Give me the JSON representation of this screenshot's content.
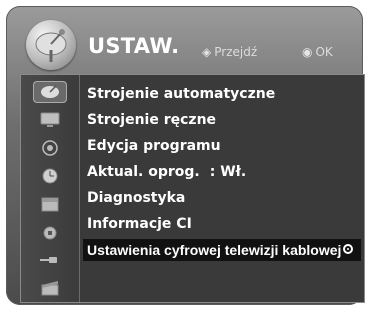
{
  "header": {
    "title": "USTAW.",
    "hint_move": "Przejdź",
    "hint_ok": "OK"
  },
  "sidebar": {
    "icons": [
      {
        "name": "satellite-dish-icon",
        "active": true
      },
      {
        "name": "screen-icon",
        "active": false
      },
      {
        "name": "audio-icon",
        "active": false
      },
      {
        "name": "clock-icon",
        "active": false
      },
      {
        "name": "calendar-icon",
        "active": false
      },
      {
        "name": "lock-icon",
        "active": false
      },
      {
        "name": "input-cable-icon",
        "active": false
      },
      {
        "name": "clapper-icon",
        "active": false
      }
    ]
  },
  "menu": {
    "items": [
      {
        "label": "Strojenie automatyczne"
      },
      {
        "label": "Strojenie ręczne"
      },
      {
        "label": "Edycja programu"
      },
      {
        "label": "Aktual. oprog.",
        "value": ": Wł."
      },
      {
        "label": "Diagnostyka"
      },
      {
        "label": "Informacje CI"
      },
      {
        "label": "Ustawienia cyfrowej telewizji kablowej"
      }
    ],
    "selected_index": 6
  }
}
